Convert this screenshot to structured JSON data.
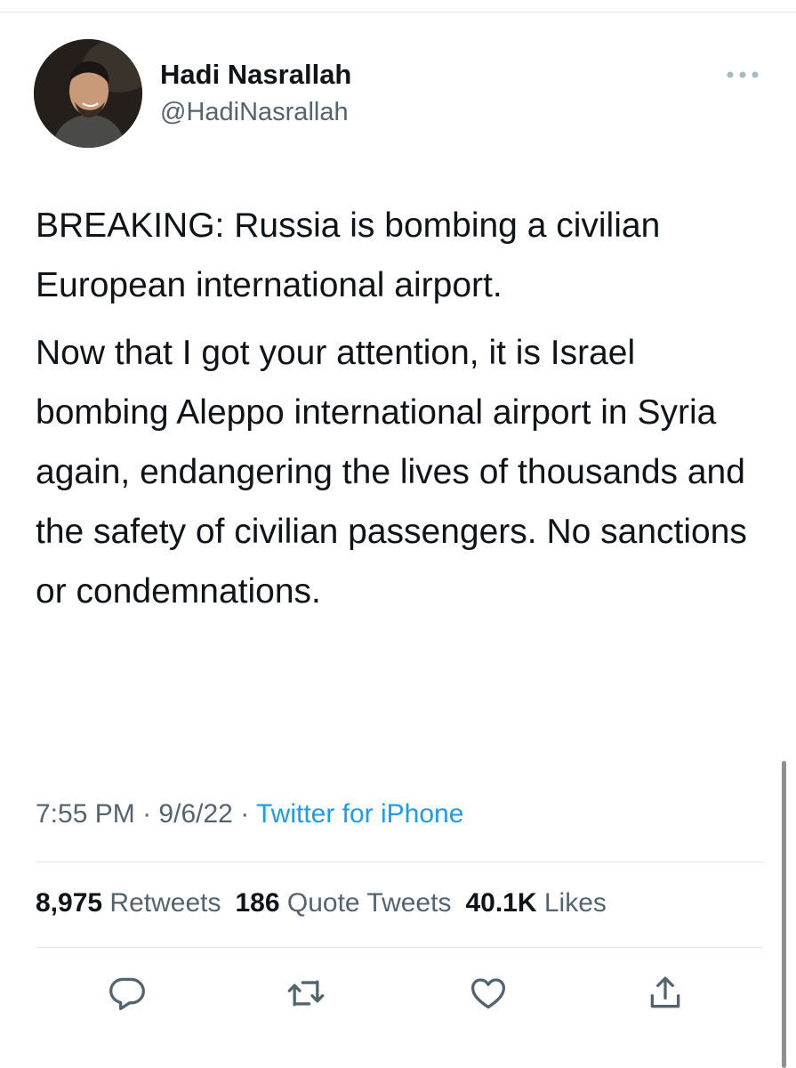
{
  "author": {
    "name": "Hadi Nasrallah",
    "handle": "@HadiNasrallah"
  },
  "tweet": {
    "paragraphs": [
      "BREAKING: Russia is bombing a civilian European international airport.",
      "Now that I got your attention, it is Israel bombing Aleppo international airport in Syria again, endangering the lives of thousands and the safety of civilian passengers. No sanctions or condemnations."
    ],
    "time": "7:55 PM",
    "date": "9/6/22",
    "source": "Twitter for iPhone"
  },
  "separator": "·",
  "stats": {
    "retweets": {
      "count": "8,975",
      "label": "Retweets"
    },
    "quote_tweets": {
      "count": "186",
      "label": "Quote Tweets"
    },
    "likes": {
      "count": "40.1K",
      "label": "Likes"
    }
  },
  "icons": {
    "more": "more-horizontal-icon",
    "reply": "reply-icon",
    "retweet": "retweet-icon",
    "like": "heart-icon",
    "share": "share-icon"
  },
  "colors": {
    "text": "#0f1419",
    "secondary": "#536471",
    "link": "#1d9bf0",
    "divider": "#e3e6e8"
  }
}
